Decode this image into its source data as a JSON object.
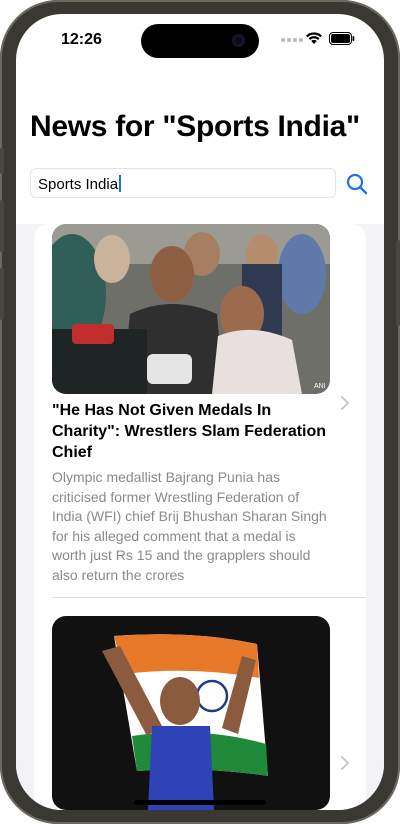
{
  "status_bar": {
    "time": "12:26"
  },
  "page": {
    "title": "News for \"Sports India\""
  },
  "search": {
    "value": "Sports India"
  },
  "articles": [
    {
      "headline": "\"He Has Not Given Medals In Charity\": Wrestlers Slam Federation Chief",
      "summary": "Olympic medallist Bajrang Punia has criticised former Wrestling Federation of India (WFI) chief Brij Bhushan Sharan Singh for his alleged comment that a medal is worth just Rs 15 and the grapplers should also return the crores",
      "image_credit": "ANI"
    },
    {
      "headline": "",
      "summary": ""
    }
  ],
  "icons": {
    "search": "search-icon",
    "chevron": "chevron-right-icon",
    "wifi": "wifi-icon",
    "battery": "battery-icon"
  },
  "colors": {
    "accent": "#1a73e8",
    "summary_text": "#8a8a8e",
    "list_background": "#f2f2f7"
  }
}
